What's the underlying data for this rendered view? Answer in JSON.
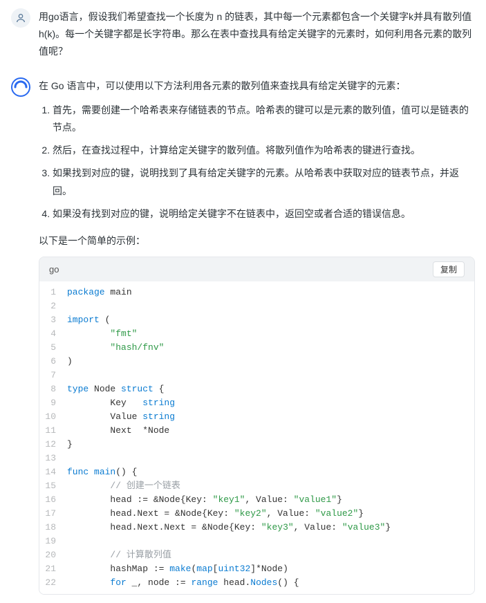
{
  "user": {
    "text": "用go语言，假设我们希望查找一个长度为 n 的链表，其中每一个元素都包含一个关键字k并具有散列值h(k)。每一个关键字都是长字符串。那么在表中查找具有给定关键字的元素时，如何利用各元素的散列值呢？"
  },
  "assistant": {
    "intro": "在 Go 语言中，可以使用以下方法利用各元素的散列值来查找具有给定关键字的元素：",
    "steps": [
      "首先，需要创建一个哈希表来存储链表的节点。哈希表的键可以是元素的散列值，值可以是链表的节点。",
      "然后，在查找过程中，计算给定关键字的散列值。将散列值作为哈希表的键进行查找。",
      "如果找到对应的键，说明找到了具有给定关键字的元素。从哈希表中获取对应的链表节点，并返回。",
      "如果没有找到对应的键，说明给定关键字不在链表中，返回空或者合适的错误信息。"
    ],
    "outro": "以下是一个简单的示例："
  },
  "code": {
    "lang": "go",
    "copy_label": "复制",
    "lines": [
      [
        {
          "t": "kw",
          "v": "package"
        },
        {
          "t": "id",
          "v": " main"
        }
      ],
      [],
      [
        {
          "t": "kw",
          "v": "import"
        },
        {
          "t": "id",
          "v": " ("
        }
      ],
      [
        {
          "t": "id",
          "v": "        "
        },
        {
          "t": "str",
          "v": "\"fmt\""
        }
      ],
      [
        {
          "t": "id",
          "v": "        "
        },
        {
          "t": "str",
          "v": "\"hash/fnv\""
        }
      ],
      [
        {
          "t": "id",
          "v": ")"
        }
      ],
      [],
      [
        {
          "t": "kw",
          "v": "type"
        },
        {
          "t": "id",
          "v": " Node "
        },
        {
          "t": "kw",
          "v": "struct"
        },
        {
          "t": "id",
          "v": " {"
        }
      ],
      [
        {
          "t": "id",
          "v": "        Key   "
        },
        {
          "t": "type",
          "v": "string"
        }
      ],
      [
        {
          "t": "id",
          "v": "        Value "
        },
        {
          "t": "type",
          "v": "string"
        }
      ],
      [
        {
          "t": "id",
          "v": "        Next  *Node"
        }
      ],
      [
        {
          "t": "id",
          "v": "}"
        }
      ],
      [],
      [
        {
          "t": "kw",
          "v": "func"
        },
        {
          "t": "id",
          "v": " "
        },
        {
          "t": "func",
          "v": "main"
        },
        {
          "t": "id",
          "v": "() {"
        }
      ],
      [
        {
          "t": "id",
          "v": "        "
        },
        {
          "t": "cmt",
          "v": "// 创建一个链表"
        }
      ],
      [
        {
          "t": "id",
          "v": "        head := &Node{Key: "
        },
        {
          "t": "str",
          "v": "\"key1\""
        },
        {
          "t": "id",
          "v": ", Value: "
        },
        {
          "t": "str",
          "v": "\"value1\""
        },
        {
          "t": "id",
          "v": "}"
        }
      ],
      [
        {
          "t": "id",
          "v": "        head.Next = &Node{Key: "
        },
        {
          "t": "str",
          "v": "\"key2\""
        },
        {
          "t": "id",
          "v": ", Value: "
        },
        {
          "t": "str",
          "v": "\"value2\""
        },
        {
          "t": "id",
          "v": "}"
        }
      ],
      [
        {
          "t": "id",
          "v": "        head.Next.Next = &Node{Key: "
        },
        {
          "t": "str",
          "v": "\"key3\""
        },
        {
          "t": "id",
          "v": ", Value: "
        },
        {
          "t": "str",
          "v": "\"value3\""
        },
        {
          "t": "id",
          "v": "}"
        }
      ],
      [],
      [
        {
          "t": "id",
          "v": "        "
        },
        {
          "t": "cmt",
          "v": "// 计算散列值"
        }
      ],
      [
        {
          "t": "id",
          "v": "        hashMap := "
        },
        {
          "t": "func",
          "v": "make"
        },
        {
          "t": "id",
          "v": "("
        },
        {
          "t": "kw",
          "v": "map"
        },
        {
          "t": "id",
          "v": "["
        },
        {
          "t": "type",
          "v": "uint32"
        },
        {
          "t": "id",
          "v": "]*Node)"
        }
      ],
      [
        {
          "t": "id",
          "v": "        "
        },
        {
          "t": "kw",
          "v": "for"
        },
        {
          "t": "id",
          "v": " _, node := "
        },
        {
          "t": "kw",
          "v": "range"
        },
        {
          "t": "id",
          "v": " head."
        },
        {
          "t": "func",
          "v": "Nodes"
        },
        {
          "t": "id",
          "v": "() {"
        }
      ]
    ]
  }
}
